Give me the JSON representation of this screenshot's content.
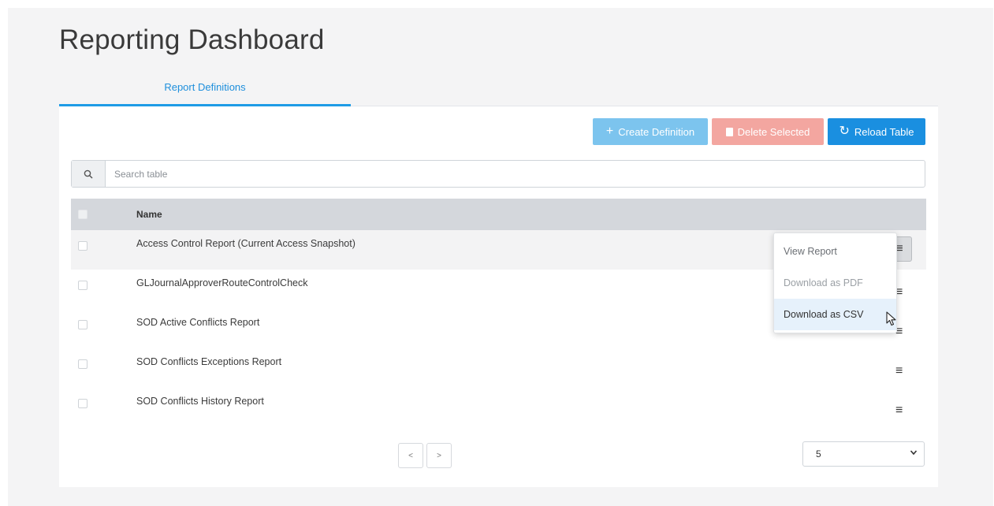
{
  "page": {
    "title": "Reporting Dashboard"
  },
  "tabs": [
    {
      "label": "Report Definitions",
      "active": true
    }
  ],
  "toolbar": {
    "create_label": "Create Definition",
    "delete_label": "Delete Selected",
    "reload_label": "Reload Table",
    "create_icon": "plus-icon",
    "delete_icon": "trash-icon",
    "reload_icon": "refresh-icon"
  },
  "search": {
    "placeholder": "Search table",
    "value": ""
  },
  "table": {
    "columns": [
      "Name"
    ],
    "rows": [
      {
        "name": "Access Control Report (Current Access Snapshot)"
      },
      {
        "name": "GLJournalApproverRouteControlCheck"
      },
      {
        "name": "SOD Active Conflicts Report"
      },
      {
        "name": "SOD Conflicts Exceptions Report"
      },
      {
        "name": "SOD Conflicts History Report"
      }
    ]
  },
  "row_menu": {
    "items": [
      "View Report",
      "Download as PDF",
      "Download as CSV"
    ],
    "hovered": "Download as CSV"
  },
  "pagination": {
    "prev": "<",
    "next": ">",
    "page_size": "5"
  },
  "colors": {
    "accent": "#1a8fe0",
    "create": "#7cc4ee",
    "delete": "#f3a6a0",
    "header_bg": "#d4d7dc"
  }
}
